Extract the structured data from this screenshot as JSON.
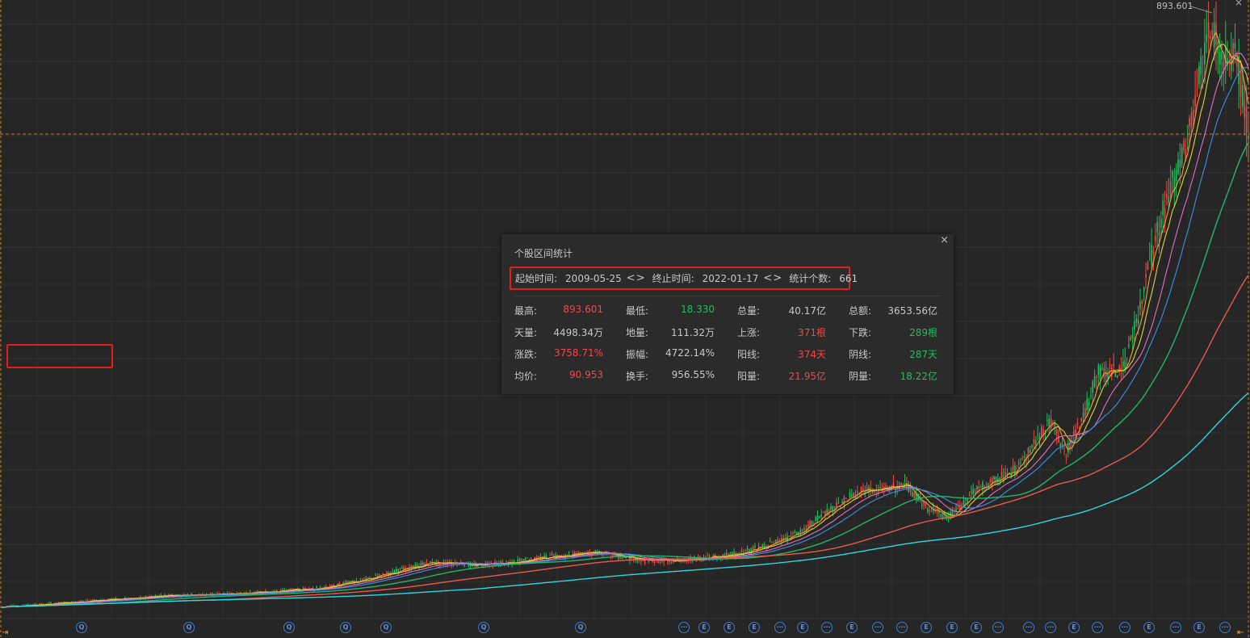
{
  "chart": {
    "peak_label": "893.601",
    "close_glyph": "×"
  },
  "panel": {
    "title": "个股区间统计",
    "close_glyph": "×",
    "range": {
      "start_label": "起始时间:",
      "start_value": "2009-05-25",
      "end_label": "终止时间:",
      "end_value": "2022-01-17",
      "count_label": "统计个数:",
      "count_value": "661",
      "arrows": "<>"
    },
    "rows": [
      [
        {
          "k": "最高:",
          "v": "893.601",
          "c": "red"
        },
        {
          "k": "最低:",
          "v": "18.330",
          "c": "green"
        },
        {
          "k": "总量:",
          "v": "40.17亿",
          "c": "white"
        },
        {
          "k": "总额:",
          "v": "3653.56亿",
          "c": "white"
        }
      ],
      [
        {
          "k": "天量:",
          "v": "4498.34万",
          "c": "white"
        },
        {
          "k": "地量:",
          "v": "111.32万",
          "c": "white"
        },
        {
          "k": "上涨:",
          "v": "371根",
          "c": "red"
        },
        {
          "k": "下跌:",
          "v": "289根",
          "c": "green"
        }
      ],
      [
        {
          "k": "涨跌:",
          "v": "3758.71%",
          "c": "red"
        },
        {
          "k": "振幅:",
          "v": "4722.14%",
          "c": "white"
        },
        {
          "k": "阳线:",
          "v": "374天",
          "c": "red"
        },
        {
          "k": "阴线:",
          "v": "287天",
          "c": "green"
        }
      ],
      [
        {
          "k": "均价:",
          "v": "90.953",
          "c": "red"
        },
        {
          "k": "换手:",
          "v": "956.55%",
          "c": "white"
        },
        {
          "k": "阳量:",
          "v": "21.95亿",
          "c": "red"
        },
        {
          "k": "阴量:",
          "v": "18.22亿",
          "c": "green"
        }
      ]
    ]
  },
  "colors": {
    "background": "#262626",
    "grid": "#343434",
    "crosshair": "#d07a20",
    "up": "#f04848",
    "down": "#1ec05a",
    "marker": "#3e7ad0"
  },
  "markers": [
    {
      "icon": "quarterly-report-icon",
      "glyph": "Q"
    },
    {
      "icon": "quarterly-report-icon",
      "glyph": "Q"
    },
    {
      "icon": "quarterly-report-icon",
      "glyph": "Q"
    },
    {
      "icon": "quarterly-report-icon",
      "glyph": "Q"
    },
    {
      "icon": "quarterly-report-icon",
      "glyph": "Q"
    },
    {
      "icon": "quarterly-report-icon",
      "glyph": "Q"
    },
    {
      "icon": "quarterly-report-icon",
      "glyph": "Q"
    },
    {
      "icon": "more-icon",
      "glyph": "···"
    },
    {
      "icon": "event-icon",
      "glyph": "E"
    },
    {
      "icon": "event-icon",
      "glyph": "E"
    },
    {
      "icon": "event-icon",
      "glyph": "E"
    },
    {
      "icon": "more-icon",
      "glyph": "···"
    },
    {
      "icon": "event-icon",
      "glyph": "E"
    },
    {
      "icon": "more-icon",
      "glyph": "···"
    },
    {
      "icon": "event-icon",
      "glyph": "E"
    },
    {
      "icon": "more-icon",
      "glyph": "···"
    },
    {
      "icon": "more-icon",
      "glyph": "···"
    },
    {
      "icon": "event-icon",
      "glyph": "E"
    },
    {
      "icon": "event-icon",
      "glyph": "E"
    },
    {
      "icon": "event-icon",
      "glyph": "E"
    },
    {
      "icon": "more-icon",
      "glyph": "···"
    },
    {
      "icon": "more-icon",
      "glyph": "···"
    },
    {
      "icon": "more-icon",
      "glyph": "···"
    },
    {
      "icon": "event-icon",
      "glyph": "E"
    },
    {
      "icon": "more-icon",
      "glyph": "···"
    },
    {
      "icon": "more-icon",
      "glyph": "···"
    },
    {
      "icon": "event-icon",
      "glyph": "E"
    },
    {
      "icon": "more-icon",
      "glyph": "···"
    },
    {
      "icon": "event-icon",
      "glyph": "E"
    },
    {
      "icon": "more-icon",
      "glyph": "···"
    }
  ]
}
